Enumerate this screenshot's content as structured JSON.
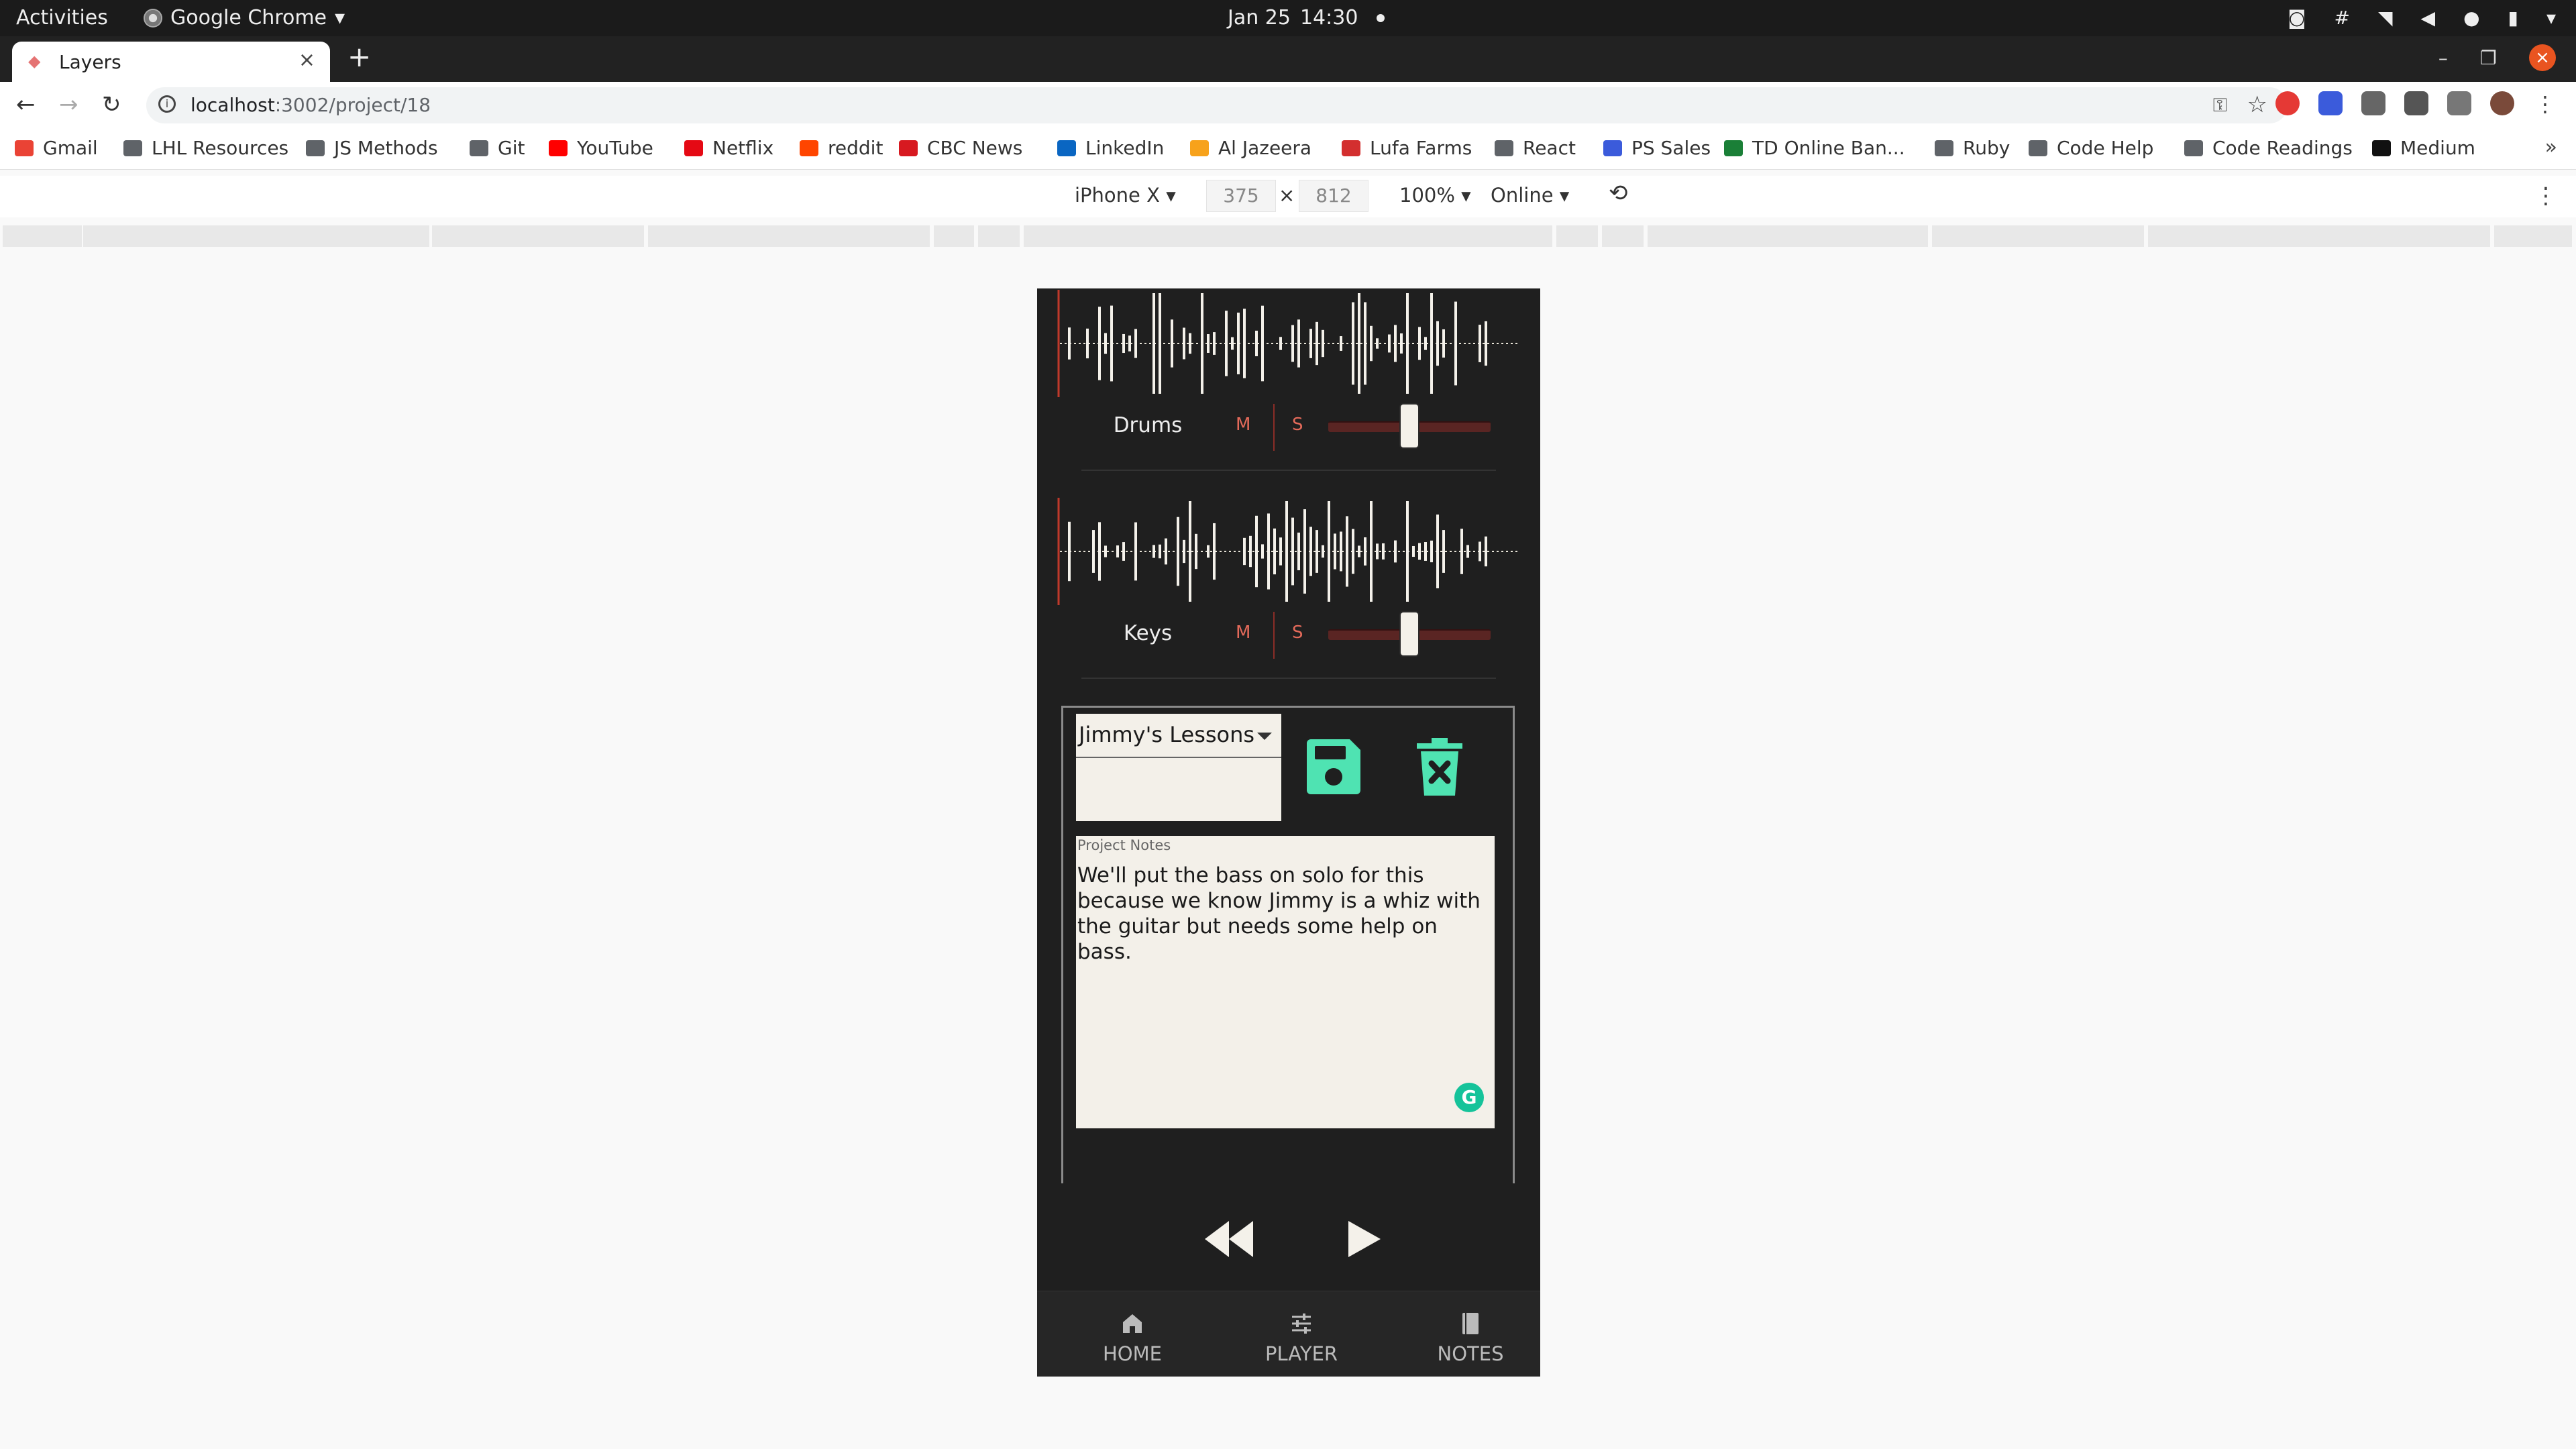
{
  "os_bar": {
    "activities": "Activities",
    "app_name": "Google Chrome",
    "date": "Jan 25",
    "time": "14:30"
  },
  "browser": {
    "tab_title": "Layers",
    "url_host": "localhost",
    "url_rest": ":3002/project/18",
    "bookmarks": [
      {
        "label": "Gmail",
        "color": "#ea4335"
      },
      {
        "label": "LHL Resources",
        "color": "#5f6368"
      },
      {
        "label": "JS Methods",
        "color": "#5f6368"
      },
      {
        "label": "Git",
        "color": "#5f6368"
      },
      {
        "label": "YouTube",
        "color": "#ff0000"
      },
      {
        "label": "Netflix",
        "color": "#e50914"
      },
      {
        "label": "reddit",
        "color": "#ff4500"
      },
      {
        "label": "CBC News",
        "color": "#d71920"
      },
      {
        "label": "LinkedIn",
        "color": "#0a66c2"
      },
      {
        "label": "Al Jazeera",
        "color": "#f7a21b"
      },
      {
        "label": "Lufa Farms",
        "color": "#d32f2f"
      },
      {
        "label": "React",
        "color": "#5f6368"
      },
      {
        "label": "PS Sales",
        "color": "#3b5bdb"
      },
      {
        "label": "TD Online Ban...",
        "color": "#1a7f37"
      },
      {
        "label": "Ruby",
        "color": "#5f6368"
      },
      {
        "label": "Code Help",
        "color": "#5f6368"
      },
      {
        "label": "Code Readings",
        "color": "#5f6368"
      },
      {
        "label": "Medium",
        "color": "#111111"
      }
    ],
    "more_bookmarks": "»"
  },
  "device_toolbar": {
    "device": "iPhone X",
    "width": "375",
    "height": "812",
    "times": "×",
    "zoom": "100%",
    "network": "Online"
  },
  "app": {
    "tracks": [
      {
        "name": "Drums",
        "mute_label": "M",
        "solo_label": "S",
        "volume": 0.5
      },
      {
        "name": "Keys",
        "mute_label": "M",
        "solo_label": "S",
        "volume": 0.5
      }
    ],
    "project_select": {
      "selected": "Jimmy's Lessons"
    },
    "notes": {
      "label": "Project Notes",
      "text": "We'll put the bass on solo for this because we know Jimmy is a whiz with the guitar but needs some help on bass."
    },
    "nav": [
      {
        "label": "HOME",
        "icon": "home-icon"
      },
      {
        "label": "PLAYER",
        "icon": "sliders-icon"
      },
      {
        "label": "NOTES",
        "icon": "notebook-icon"
      }
    ],
    "colors": {
      "accent": "#4fe3b2",
      "background": "#1f1f1f",
      "paper": "#f3f0e9",
      "mute_solo": "#e46a5a"
    }
  }
}
